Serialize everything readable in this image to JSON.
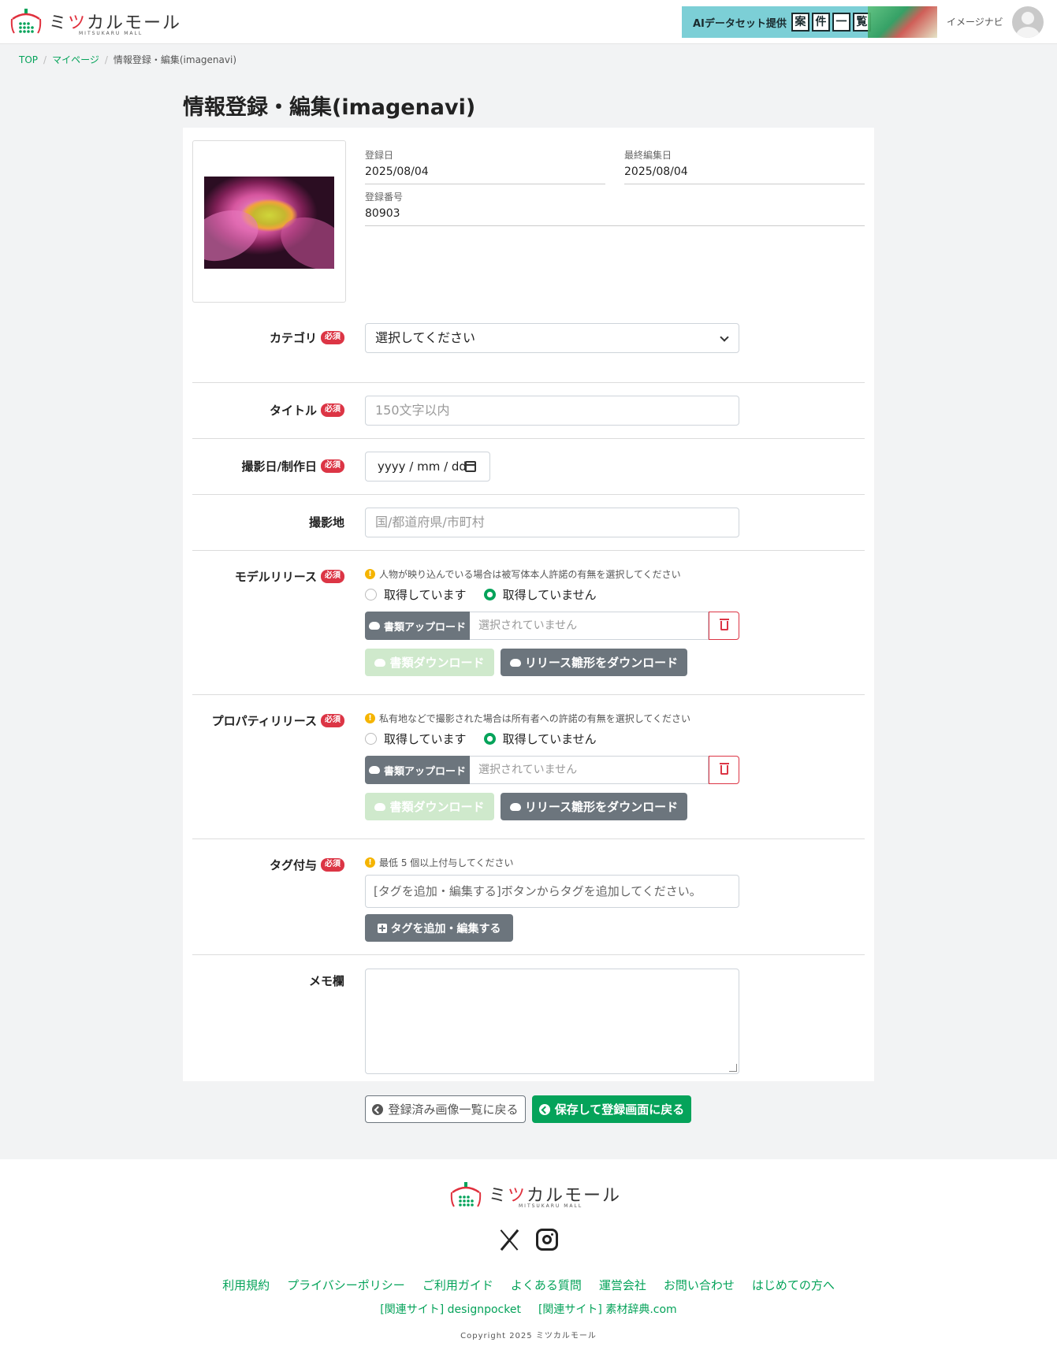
{
  "header": {
    "brand": "ミツカルモール",
    "brand_sub": "MITSUKARU MALL",
    "banner_text": "AIデータセット提供",
    "banner_boxes": [
      "案",
      "件",
      "一",
      "覧"
    ],
    "user_name": "イメージナビ"
  },
  "breadcrumb": [
    "TOP",
    "マイページ",
    "情報登録・編集(imagenavi)"
  ],
  "page_title": "情報登録・編集(imagenavi)",
  "meta": {
    "registered_label": "登録日",
    "registered_value": "2025/08/04",
    "edited_label": "最終編集日",
    "edited_value": "2025/08/04",
    "number_label": "登録番号",
    "number_value": "80903"
  },
  "required_badge": "必須",
  "fields": {
    "category_label": "カテゴリ",
    "category_value": "選択してください",
    "title_label": "タイトル",
    "title_placeholder": "150文字以内",
    "date_label": "撮影日/制作日",
    "date_placeholder": "yyyy / mm / dd",
    "place_label": "撮影地",
    "place_placeholder": "国/都道府県/市町村"
  },
  "model_release": {
    "label": "モデルリリース",
    "note": "人物が映り込んでいる場合は被写体本人許諾の有無を選択してください",
    "option_yes": "取得しています",
    "option_no": "取得していません",
    "selected": "no",
    "upload_button": "書類アップロード",
    "upload_file": "選択されていません",
    "download_button": "書類ダウンロード",
    "template_button": "リリース雛形をダウンロード"
  },
  "property_release": {
    "label": "プロパティリリース",
    "note": "私有地などで撮影された場合は所有者への許諾の有無を選択してください",
    "option_yes": "取得しています",
    "option_no": "取得していません",
    "selected": "no",
    "upload_button": "書類アップロード",
    "upload_file": "選択されていません",
    "download_button": "書類ダウンロード",
    "template_button": "リリース雛形をダウンロード"
  },
  "tags": {
    "label": "タグ付与",
    "note": "最低 5 個以上付与してください",
    "placeholder": "[タグを追加・編集する]ボタンからタグを追加してください。",
    "button": "タグを追加・編集する"
  },
  "memo": {
    "label": "メモ欄"
  },
  "actions": {
    "back": "登録済み画像一覧に戻る",
    "save": "保存して登録画面に戻る"
  },
  "footer": {
    "brand": "ミツカルモール",
    "brand_sub": "MITSUKARU MALL",
    "links": [
      "利用規約",
      "プライバシーポリシー",
      "ご利用ガイド",
      "よくある質問",
      "運営会社",
      "お問い合わせ",
      "はじめての方へ"
    ],
    "related": [
      "[関連サイト] designpocket",
      "[関連サイト] 素材辞典.com"
    ],
    "copyright": "Copyright 2025 ミツカルモール"
  },
  "colors": {
    "accent": "#05a35a",
    "danger": "#dc3545",
    "secondary": "#6c757d",
    "warning": "#f5b400"
  }
}
